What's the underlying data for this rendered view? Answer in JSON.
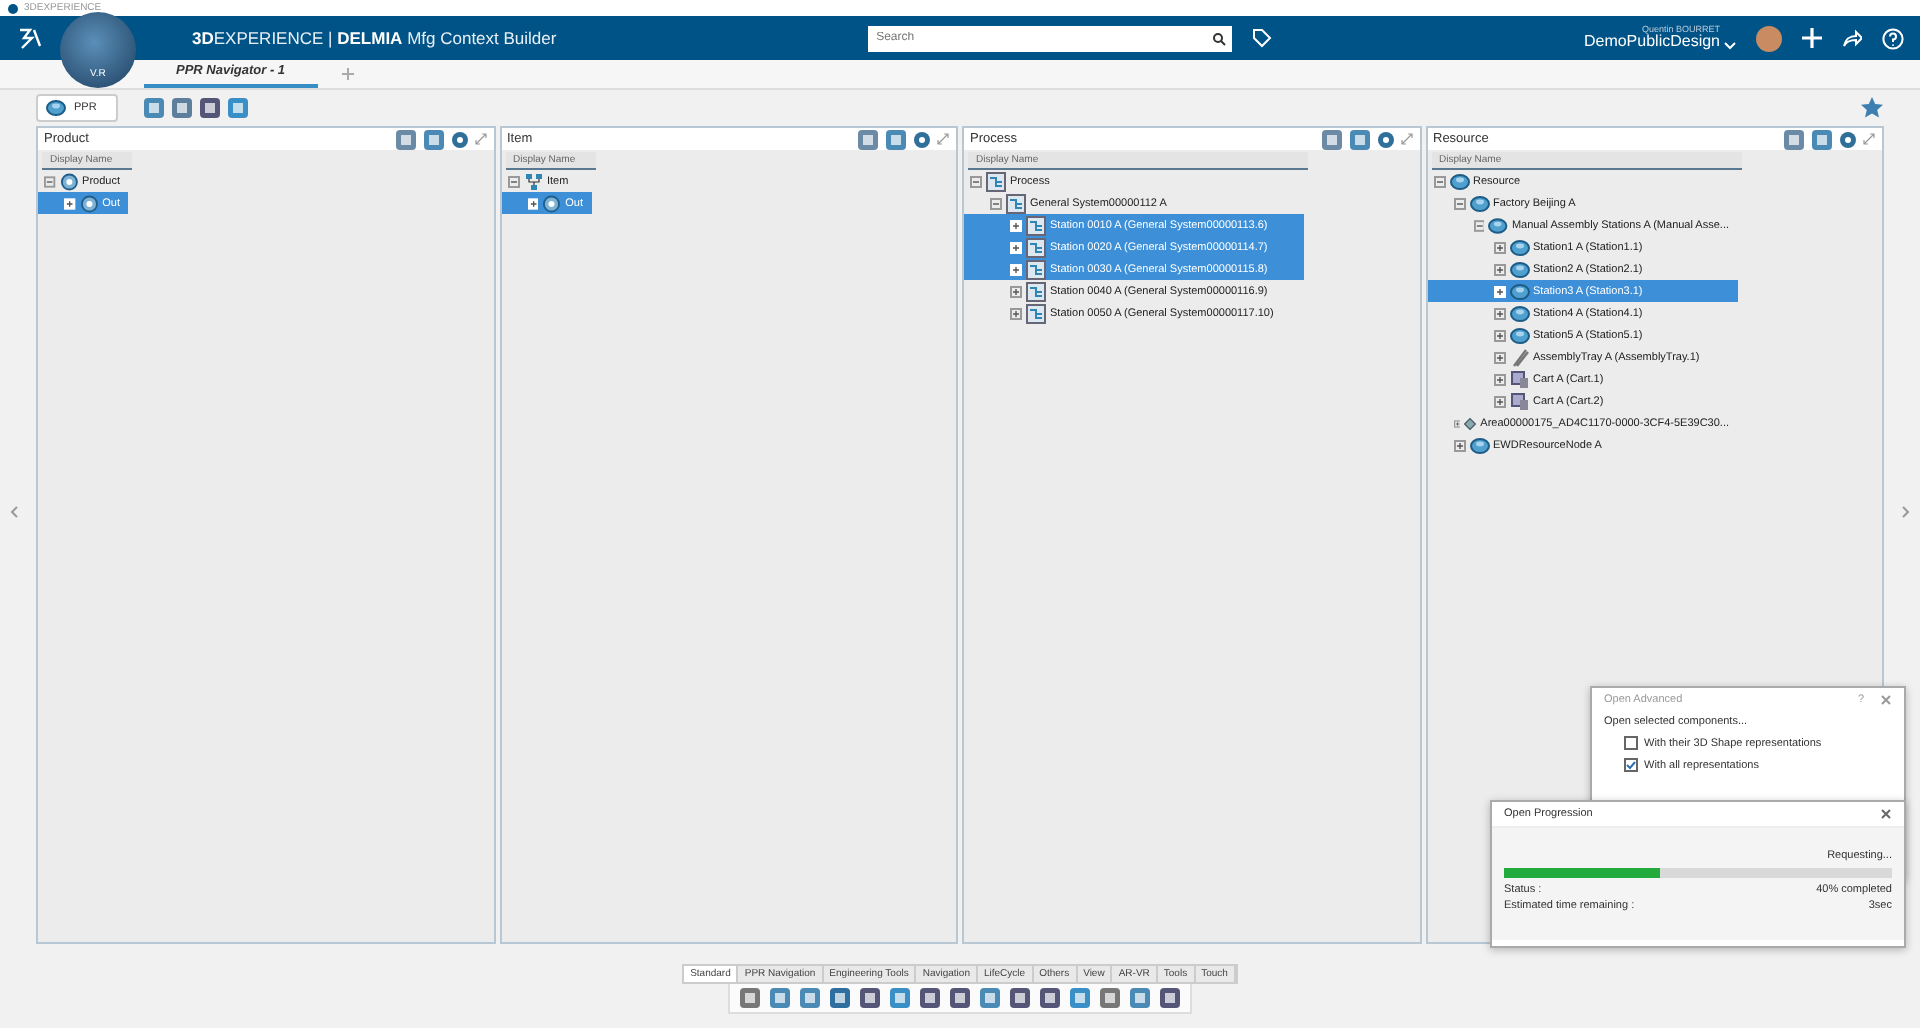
{
  "title_bar": {
    "title": "3DEXPERIENCE"
  },
  "header": {
    "compass_label": "V.R",
    "brand": "**3D**EXPERIENCE | **DELMIA** Mfg Context Builder",
    "search": {
      "placeholder": "Search"
    },
    "user": "Quentin BOURRET",
    "workspace": "DemoPublicDesign"
  },
  "tabs": [
    {
      "label": "PPR Navigator - 1",
      "selected": true
    }
  ],
  "ppr_button": "PPR",
  "panels": [
    {
      "title": "Product",
      "column": "Display Name",
      "tree": [
        {
          "label": "Product",
          "kind": "product",
          "expanded": true,
          "selected": false,
          "children": [
            {
              "label": "Out",
              "kind": "product",
              "expanded": false,
              "selected": true
            }
          ]
        }
      ]
    },
    {
      "title": "Item",
      "column": "Display Name",
      "tree": [
        {
          "label": "Item",
          "kind": "item",
          "expanded": true,
          "selected": false,
          "children": [
            {
              "label": "Out",
              "kind": "product",
              "expanded": false,
              "selected": true
            }
          ]
        }
      ]
    },
    {
      "title": "Process",
      "column": "Display Name",
      "tree": [
        {
          "label": "Process",
          "kind": "process",
          "expanded": true,
          "selected": false,
          "children": [
            {
              "label": "General System00000112 A",
              "kind": "system",
              "expanded": true,
              "selected": false,
              "children": [
                {
                  "label": "Station 0010 A (General System00000113.6)",
                  "kind": "system",
                  "expanded": false,
                  "selected": true
                },
                {
                  "label": "Station 0020 A (General System00000114.7)",
                  "kind": "system",
                  "expanded": false,
                  "selected": true
                },
                {
                  "label": "Station 0030 A (General System00000115.8)",
                  "kind": "system",
                  "expanded": false,
                  "selected": true
                },
                {
                  "label": "Station 0040 A (General System00000116.9)",
                  "kind": "system",
                  "expanded": false,
                  "selected": false
                },
                {
                  "label": "Station 0050 A (General System00000117.10)",
                  "kind": "system",
                  "expanded": false,
                  "selected": false
                }
              ]
            }
          ]
        }
      ]
    },
    {
      "title": "Resource",
      "column": "Display Name",
      "tree": [
        {
          "label": "Resource",
          "kind": "resource",
          "expanded": true,
          "selected": false,
          "children": [
            {
              "label": "Factory Beijing A",
              "kind": "resource",
              "expanded": true,
              "selected": false,
              "children": [
                {
                  "label": "Manual Assembly Stations A (Manual Asse...",
                  "kind": "resource",
                  "expanded": true,
                  "selected": false,
                  "children": [
                    {
                      "label": "Station1 A (Station1.1)",
                      "kind": "resource",
                      "expanded": false,
                      "selected": false
                    },
                    {
                      "label": "Station2 A (Station2.1)",
                      "kind": "resource",
                      "expanded": false,
                      "selected": false
                    },
                    {
                      "label": "Station3 A (Station3.1)",
                      "kind": "resource",
                      "expanded": false,
                      "selected": true
                    },
                    {
                      "label": "Station4 A (Station4.1)",
                      "kind": "resource",
                      "expanded": false,
                      "selected": false
                    },
                    {
                      "label": "Station5 A (Station5.1)",
                      "kind": "resource",
                      "expanded": false,
                      "selected": false
                    },
                    {
                      "label": "AssemblyTray A (AssemblyTray.1)",
                      "kind": "tray",
                      "expanded": false,
                      "selected": false
                    },
                    {
                      "label": "Cart A (Cart.1)",
                      "kind": "cart",
                      "expanded": false,
                      "selected": false
                    },
                    {
                      "label": "Cart A (Cart.2)",
                      "kind": "cart",
                      "expanded": false,
                      "selected": false
                    }
                  ]
                }
              ]
            },
            {
              "label": "Area00000175_AD4C1170-0000-3CF4-5E39C30...",
              "kind": "area",
              "expanded": false,
              "selected": false
            },
            {
              "label": "EWDResourceNode A",
              "kind": "resource",
              "expanded": false,
              "selected": false
            }
          ]
        }
      ]
    }
  ],
  "open_advanced": {
    "title": "Open Advanced",
    "help": "?",
    "heading": "Open selected components...",
    "options": [
      {
        "label": "With their 3D Shape representations",
        "checked": false
      },
      {
        "label": "With all representations",
        "checked": true
      }
    ]
  },
  "open_progression": {
    "title": "Open Progression",
    "state": "Requesting...",
    "level": 0.4,
    "status_label": "Status :",
    "status_value": "40% completed",
    "time_label": "Estimated time remaining :",
    "time_value": "3sec"
  },
  "toolbar_tabs": [
    {
      "label": "Standard",
      "selected": true
    },
    {
      "label": "PPR Navigation",
      "selected": false
    },
    {
      "label": "Engineering Tools",
      "selected": false
    },
    {
      "label": "Navigation",
      "selected": false
    },
    {
      "label": "LifeCycle",
      "selected": false
    },
    {
      "label": "Others",
      "selected": false
    },
    {
      "label": "View",
      "selected": false
    },
    {
      "label": "AR-VR",
      "selected": false
    },
    {
      "label": "Tools",
      "selected": false
    },
    {
      "label": "Touch",
      "selected": false
    }
  ]
}
